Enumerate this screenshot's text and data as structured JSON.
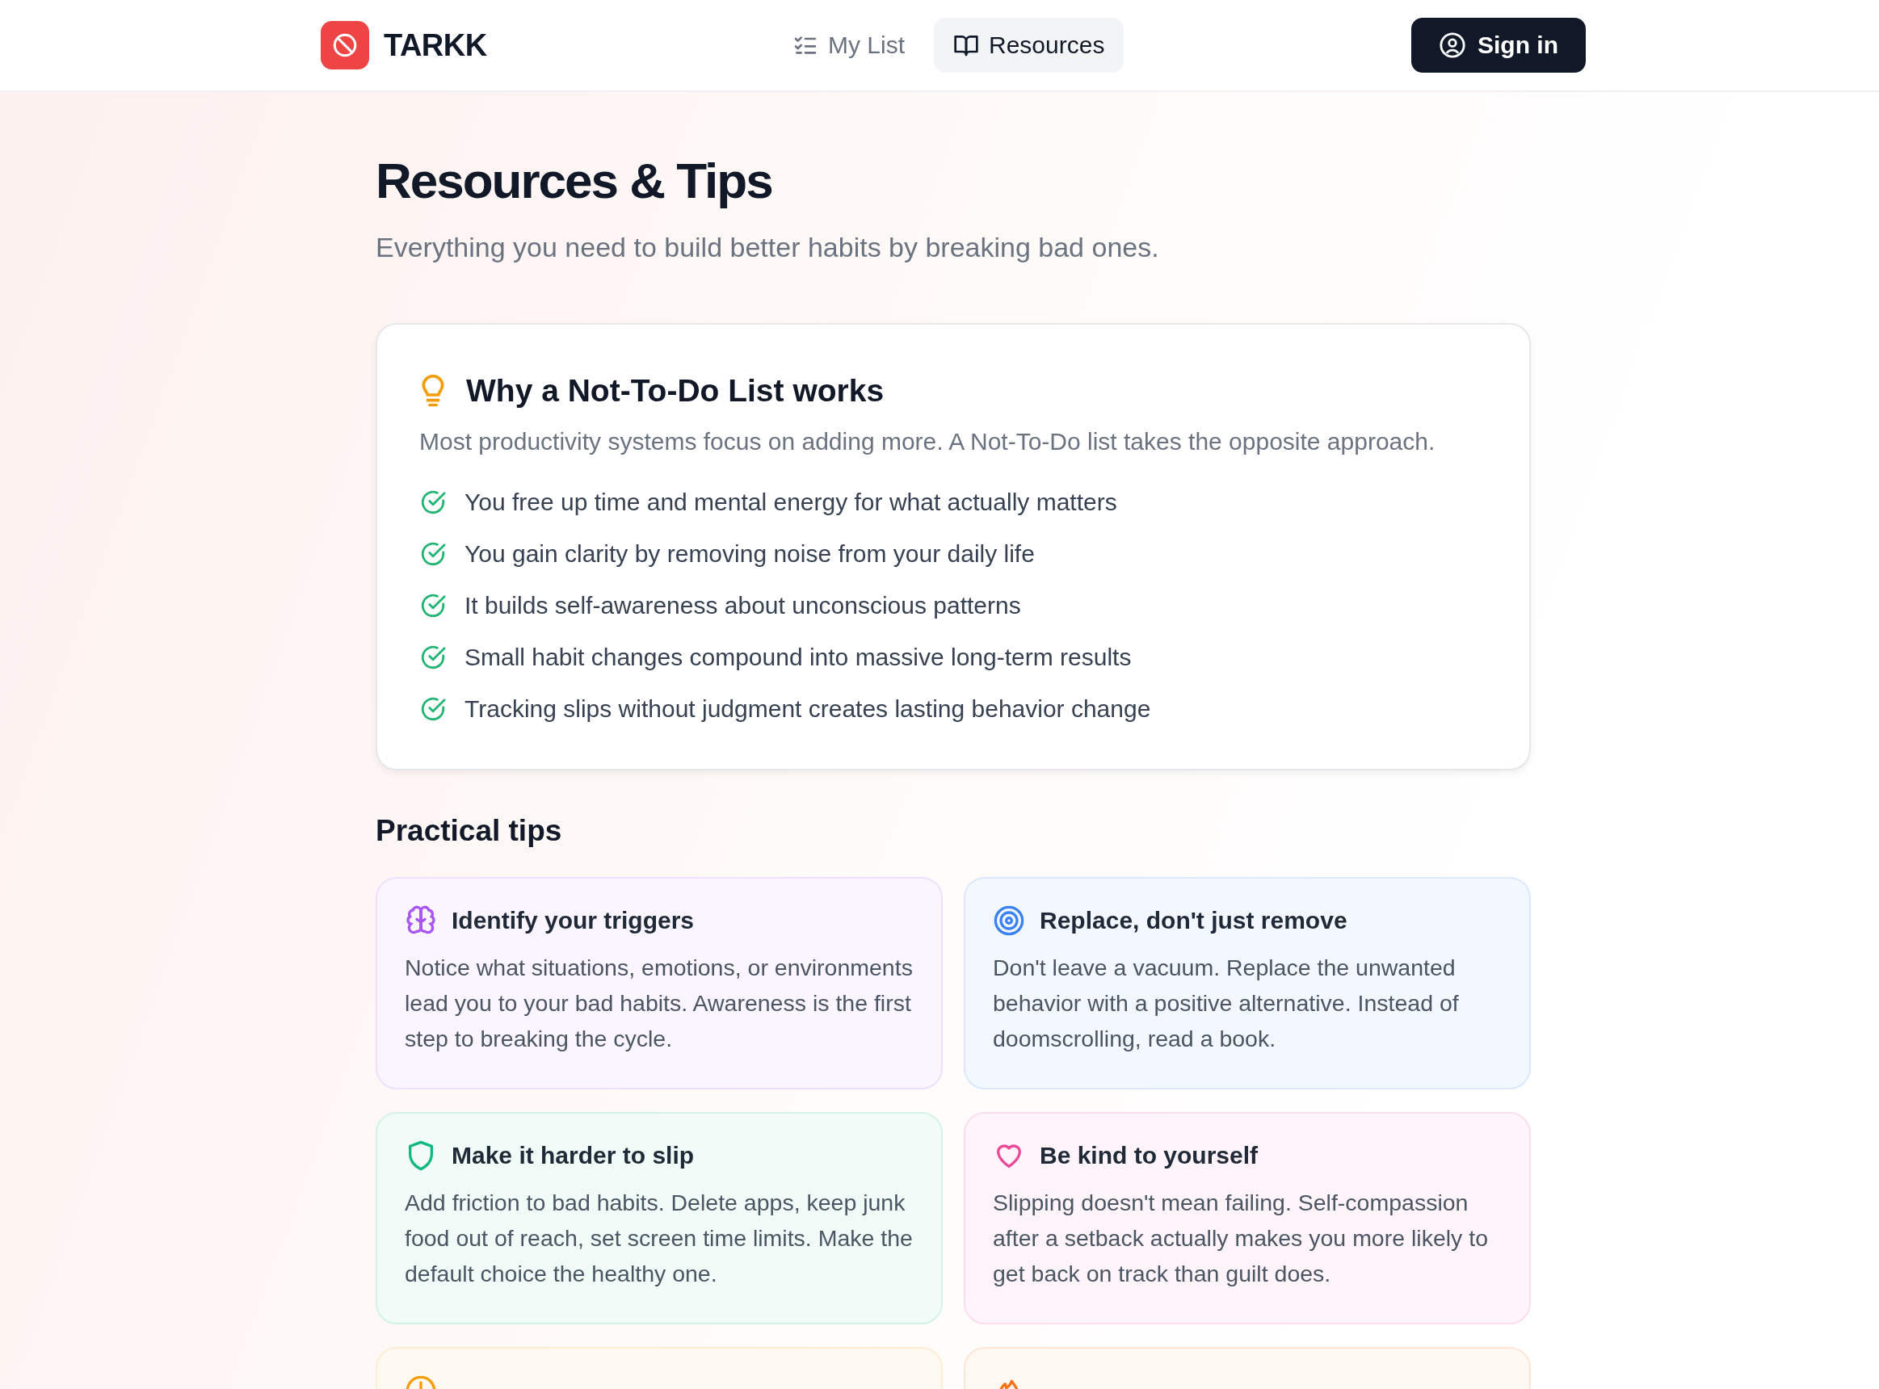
{
  "header": {
    "brand": "TARKK",
    "nav": [
      {
        "label": "My List",
        "kind": "list",
        "selected": false
      },
      {
        "label": "Resources",
        "kind": "book",
        "selected": true
      }
    ],
    "sign_in": "Sign in"
  },
  "page": {
    "title": "Resources & Tips",
    "subtitle": "Everything you need to build better habits by breaking bad ones."
  },
  "why_card": {
    "title": "Why a Not-To-Do List works",
    "intro": "Most productivity systems focus on adding more. A Not-To-Do list takes the opposite approach.",
    "points": [
      "You free up time and mental energy for what actually matters",
      "You gain clarity by removing noise from your daily life",
      "It builds self-awareness about unconscious patterns",
      "Small habit changes compound into massive long-term results",
      "Tracking slips without judgment creates lasting behavior change"
    ]
  },
  "tips": {
    "heading": "Practical tips",
    "items": [
      {
        "kind": "brain",
        "color": "#a855f7",
        "title": "Identify your triggers",
        "body": "Notice what situations, emotions, or environments lead you to your bad habits. Awareness is the first step to breaking the cycle."
      },
      {
        "kind": "target",
        "color": "#3b82f6",
        "title": "Replace, don't just remove",
        "body": "Don't leave a vacuum. Replace the unwanted behavior with a positive alternative. Instead of doomscrolling, read a book."
      },
      {
        "kind": "shield",
        "color": "#10b981",
        "title": "Make it harder to slip",
        "body": "Add friction to bad habits. Delete apps, keep junk food out of reach, set screen time limits. Make the default choice the healthy one."
      },
      {
        "kind": "heart",
        "color": "#ec4899",
        "title": "Be kind to yourself",
        "body": "Slipping doesn't mean failing. Self-compassion after a setback actually makes you more likely to get back on track than guilt does."
      },
      {
        "kind": "clock",
        "color": "#f59e0b"
      },
      {
        "kind": "flame",
        "color": "#f97316"
      }
    ]
  }
}
